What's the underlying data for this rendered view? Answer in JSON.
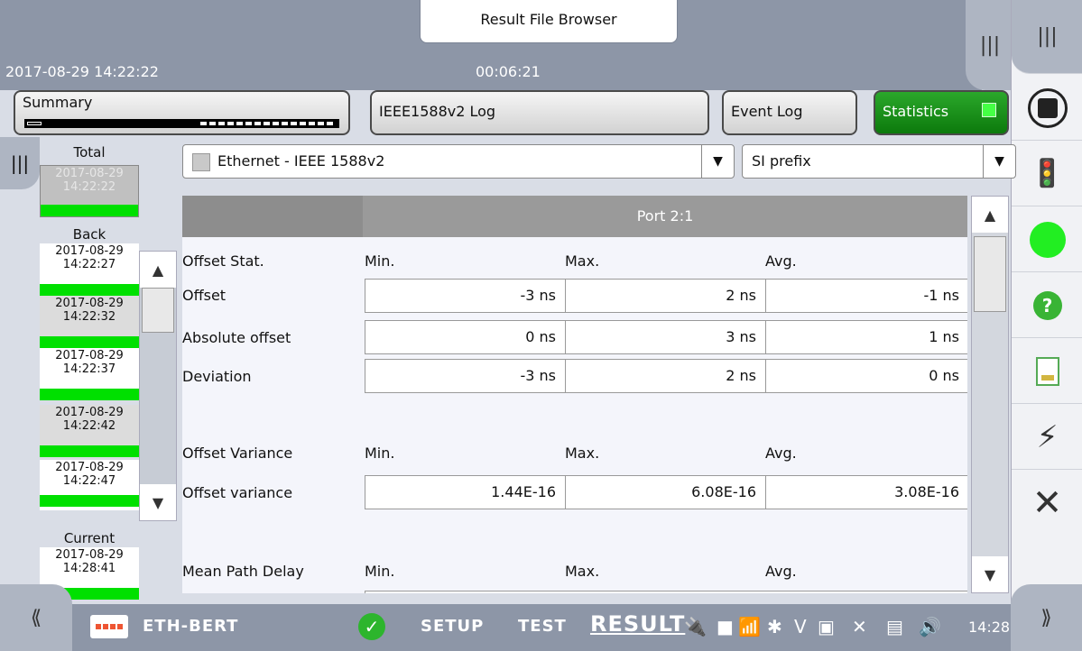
{
  "window": {
    "title": "Result File Browser",
    "datetime": "2017-08-29 14:22:22",
    "elapsed": "00:06:21"
  },
  "tabs": {
    "summary": "Summary",
    "log": "IEEE1588v2 Log",
    "event": "Event Log",
    "statistics": "Statistics"
  },
  "history": {
    "total_label": "Total",
    "total_item": {
      "date": "2017-08-29",
      "time": "14:22:22"
    },
    "back_label": "Back",
    "back_items": [
      {
        "date": "2017-08-29",
        "time": "14:22:27"
      },
      {
        "date": "2017-08-29",
        "time": "14:22:32"
      },
      {
        "date": "2017-08-29",
        "time": "14:22:37"
      },
      {
        "date": "2017-08-29",
        "time": "14:22:42"
      },
      {
        "date": "2017-08-29",
        "time": "14:22:47"
      }
    ],
    "current_label": "Current",
    "current_item": {
      "date": "2017-08-29",
      "time": "14:28:41"
    }
  },
  "filters": {
    "protocol": "Ethernet - IEEE 1588v2",
    "prefix": "SI prefix"
  },
  "table": {
    "port": "Port 2:1",
    "sections": [
      {
        "title": "Offset Stat.",
        "cols": [
          "Min.",
          "Max.",
          "Avg."
        ],
        "rows": [
          {
            "label": "Offset",
            "values": [
              "-3 ns",
              "2 ns",
              "-1 ns"
            ]
          },
          {
            "label": "Absolute offset",
            "values": [
              "0 ns",
              "3 ns",
              "1 ns"
            ]
          },
          {
            "label": "Deviation",
            "values": [
              "-3 ns",
              "2 ns",
              "0 ns"
            ]
          }
        ]
      },
      {
        "title": "Offset Variance",
        "cols": [
          "Min.",
          "Max.",
          "Avg."
        ],
        "rows": [
          {
            "label": "Offset variance",
            "values": [
              "1.44E-16",
              "6.08E-16",
              "3.08E-16"
            ]
          }
        ]
      },
      {
        "title": "Mean Path Delay",
        "cols": [
          "Min.",
          "Max.",
          "Avg."
        ],
        "rows": []
      }
    ]
  },
  "bottombar": {
    "app": "ETH-BERT",
    "setup": "SETUP",
    "test": "TEST",
    "result": "RESULT",
    "time": "14:28"
  },
  "colors": {
    "accent_green": "#0c7a0c",
    "status_green": "#00e000",
    "bar_gray": "#8d96a7"
  }
}
